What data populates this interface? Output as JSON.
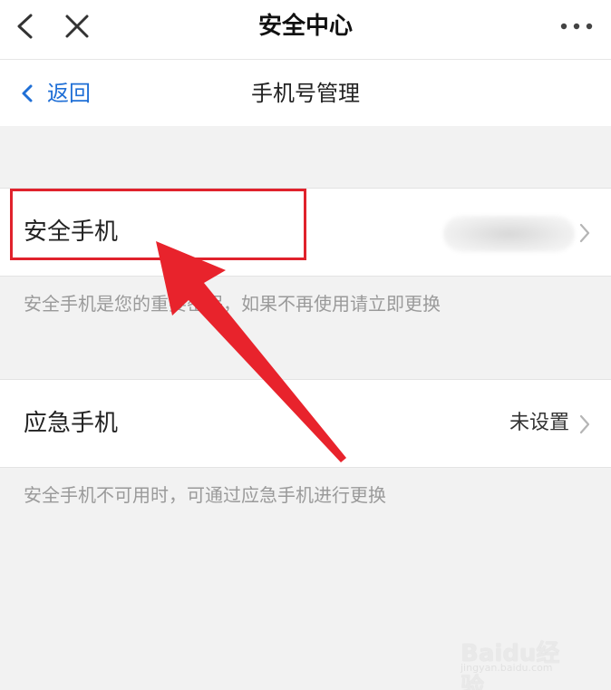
{
  "topbar": {
    "title": "安全中心"
  },
  "navbar": {
    "back_label": "返回",
    "title": "手机号管理"
  },
  "security_phone": {
    "label": "安全手机",
    "hint": "安全手机是您的重要密保，如果不再使用请立即更换"
  },
  "emergency_phone": {
    "label": "应急手机",
    "value": "未设置",
    "hint": "安全手机不可用时，可通过应急手机进行更换"
  },
  "watermark": {
    "brand": "Baidu经验",
    "url": "jingyan.baidu.com"
  },
  "colors": {
    "accent": "#1f6fd6",
    "annotation": "#e0222c",
    "background": "#f2f2f2"
  }
}
